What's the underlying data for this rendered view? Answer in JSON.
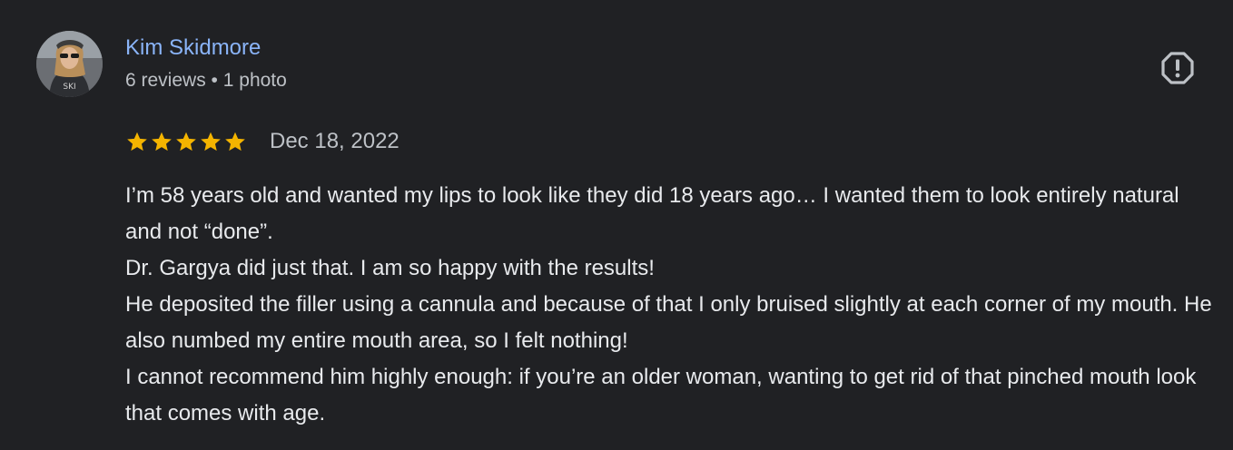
{
  "author": {
    "name": "Kim Skidmore",
    "reviews_count": "6 reviews",
    "separator": "•",
    "photos_count": "1 photo",
    "avatar_icon": "profile-photo-avatar"
  },
  "report_icon": "report-octagon-exclamation-icon",
  "rating": {
    "stars": 5,
    "max_stars": 5,
    "star_color": "#f4b400",
    "date": "Dec 18, 2022"
  },
  "review": {
    "paragraphs": [
      "I’m 58 years old and wanted my lips to look like they did 18 years ago… I wanted them to look entirely natural and not “done”.",
      "Dr. Gargya did just that. I am so happy with the results!",
      "He deposited the filler using a cannula and because of that I only bruised slightly at each corner of my mouth. He also numbed my entire mouth area, so I felt nothing!",
      "I cannot recommend him highly enough: if you’re an older woman, wanting to get rid of that pinched mouth look that comes with age."
    ]
  },
  "colors": {
    "background": "#202124",
    "name_link": "#8ab4f8",
    "secondary_text": "#bdc1c6",
    "primary_text": "#e8eaed"
  }
}
